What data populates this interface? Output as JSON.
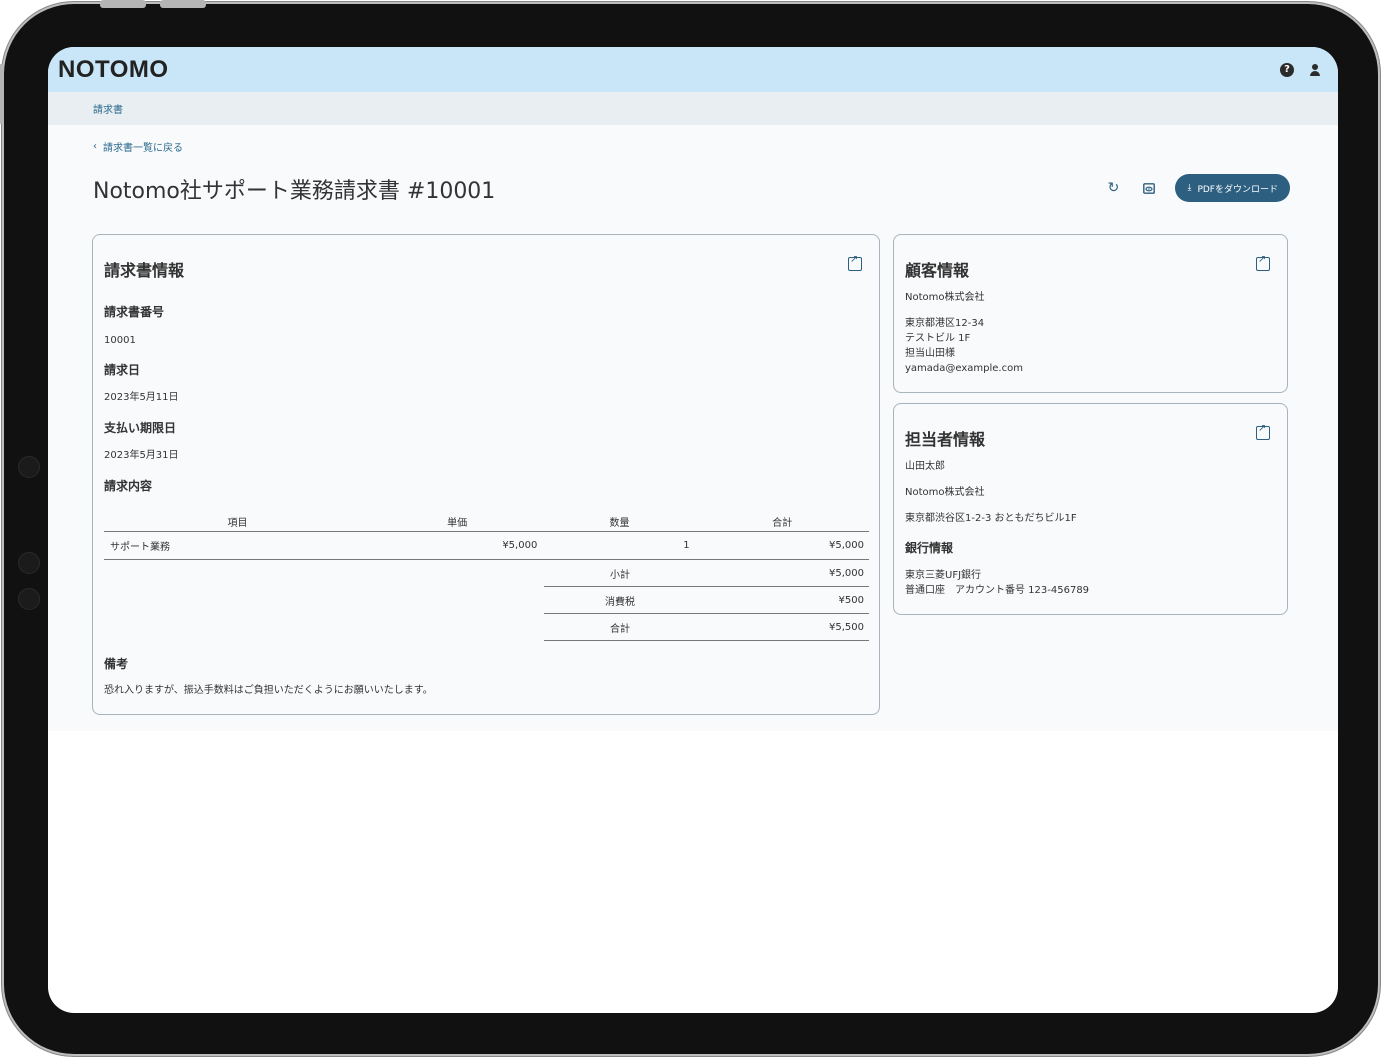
{
  "app": {
    "logo": "NOTOMO"
  },
  "breadcrumb": "請求書",
  "back_link": "請求書一覧に戻る",
  "page_title": "Notomo社サポート業務請求書 #10001",
  "toolbar": {
    "pdf_button": "PDFをダウンロード"
  },
  "invoice_card": {
    "title": "請求書情報",
    "number_label": "請求書番号",
    "number_value": "10001",
    "date_label": "請求日",
    "date_value": "2023年5月11日",
    "due_label": "支払い期限日",
    "due_value": "2023年5月31日",
    "content_label": "請求内容",
    "table": {
      "headers": [
        "項目",
        "単価",
        "数量",
        "合計"
      ],
      "rows": [
        {
          "item": "サポート業務",
          "unit_price": "¥5,000",
          "qty": "1",
          "total": "¥5,000"
        }
      ]
    },
    "summary": [
      {
        "label": "小計",
        "value": "¥5,000"
      },
      {
        "label": "消費税",
        "value": "¥500"
      },
      {
        "label": "合計",
        "value": "¥5,500"
      }
    ],
    "notes_label": "備考",
    "notes_value": "恐れ入りますが、振込手数料はご負担いただくようにお願いいたします。"
  },
  "customer_card": {
    "title": "顧客情報",
    "company": "Notomo株式会社",
    "address_lines": [
      "東京都港区12-34",
      "テストビル 1F",
      "担当山田様",
      "yamada@example.com"
    ]
  },
  "staff_card": {
    "title": "担当者情報",
    "name": "山田太郎",
    "company": "Notomo株式会社",
    "address": "東京都渋谷区1-2-3 おともだちビル1F",
    "bank_label": "銀行情報",
    "bank_lines": [
      "東京三菱UFJ銀行",
      "普通口座　アカウント番号 123-456789"
    ]
  }
}
